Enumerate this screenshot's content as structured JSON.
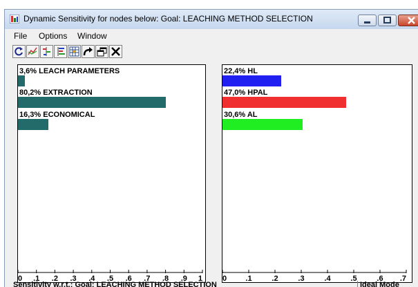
{
  "window": {
    "title": "Dynamic Sensitivity for nodes below: Goal: LEACHING METHOD SELECTION"
  },
  "menu": [
    "File",
    "Options",
    "Window"
  ],
  "toolbar": [
    "refresh-icon",
    "graph-icon",
    "sort-icon",
    "tree-icon",
    "grid-icon",
    "redo-arrow-icon",
    "windows-icon",
    "close-x-icon"
  ],
  "left_panel": {
    "bars": [
      {
        "label": "3,6% LEACH PARAMETERS",
        "value": 0.036,
        "color": "#236b6b"
      },
      {
        "label": "80,2% EXTRACTION",
        "value": 0.802,
        "color": "#236b6b"
      },
      {
        "label": "16,3% ECONOMICAL",
        "value": 0.163,
        "color": "#236b6b"
      }
    ],
    "axis_max": 1,
    "ticks": [
      "0",
      ".1",
      ".2",
      ".3",
      ".4",
      ".5",
      ".6",
      ".7",
      ".8",
      ".9",
      "1"
    ]
  },
  "right_panel": {
    "bars": [
      {
        "label": "22,4% HL",
        "value": 0.224,
        "color": "#2020f0"
      },
      {
        "label": "47,0% HPAL",
        "value": 0.47,
        "color": "#f03030"
      },
      {
        "label": "30,6% AL",
        "value": 0.306,
        "color": "#20ee20"
      }
    ],
    "axis_max": 0.7,
    "ticks": [
      "0",
      ".1",
      ".2",
      ".3",
      ".4",
      ".5",
      ".6",
      ".7"
    ]
  },
  "status": {
    "text": "Sensitivity w.r.t.: Goal: LEACHING METHOD SELECTION",
    "mode": "Ideal Mode"
  }
}
